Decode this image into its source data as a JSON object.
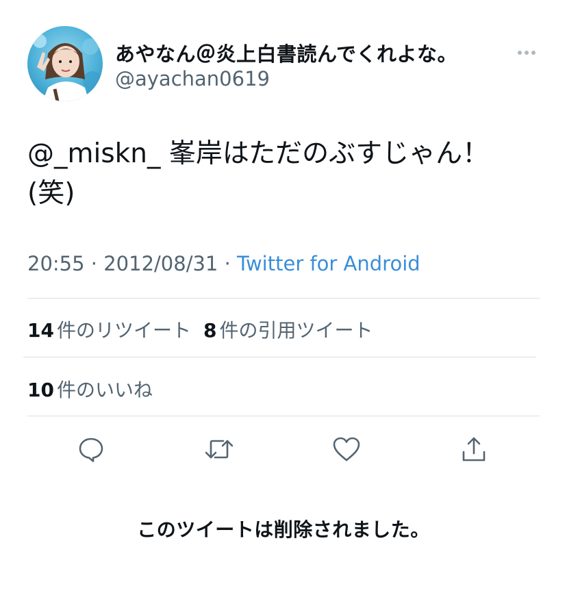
{
  "author": {
    "display_name": "あやなん＠炎上白書読んでくれよな。",
    "handle": "@ayachan0619",
    "avatar_icon": "user-avatar-photo"
  },
  "header": {
    "more_icon": "more-dots-icon"
  },
  "tweet": {
    "mention": "@_miskn_",
    "text_line1": " 峯岸はただのぶすじゃん！",
    "text_line2": "(笑)"
  },
  "meta": {
    "time": "20:55",
    "separator1": " · ",
    "date": "2012/08/31",
    "separator2": " · ",
    "source": "Twitter for Android"
  },
  "stats": {
    "retweets_count": "14",
    "retweets_label": "件のリツイート",
    "quotes_count": "8",
    "quotes_label": "件の引用ツイート",
    "likes_count": "10",
    "likes_label": "件のいいね"
  },
  "actions": [
    {
      "name": "reply",
      "icon": "reply-bubble-icon"
    },
    {
      "name": "retweet",
      "icon": "retweet-icon"
    },
    {
      "name": "like",
      "icon": "heart-icon"
    },
    {
      "name": "share",
      "icon": "share-icon"
    }
  ],
  "notice": {
    "deleted": "このツイートは削除されました。"
  },
  "colors": {
    "text_primary": "#0f1419",
    "text_secondary": "#536471",
    "link": "#3a8ed8",
    "icon": "#536471",
    "divider": "#dadfe3"
  }
}
